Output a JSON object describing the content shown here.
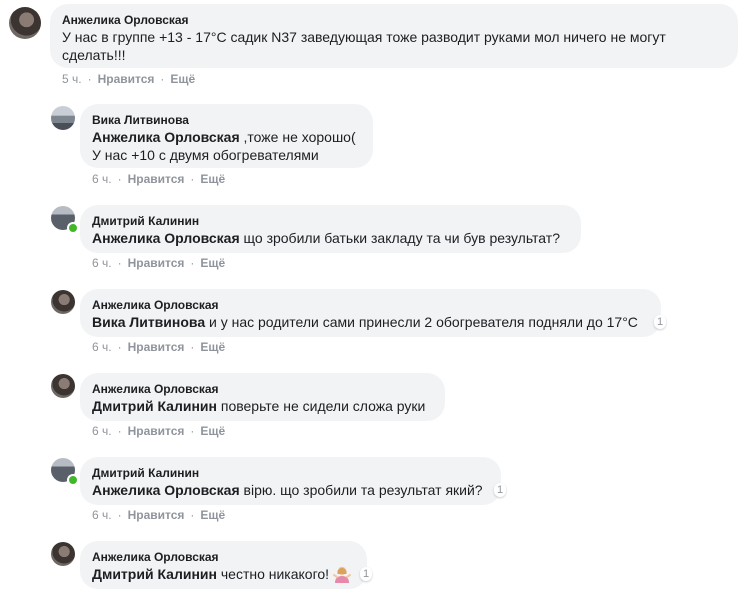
{
  "comments": [
    {
      "author": "Анжелика Орловская",
      "mention": "",
      "text": "У нас в группе +13 - 17°С садик N37 заведующая тоже разводит руками мол ничего не могут сделать!!!",
      "time": "5 ч.",
      "like": "Нравится",
      "more": "Ещё",
      "reactions": ""
    },
    {
      "author": "Вика Литвинова",
      "mention": "Анжелика Орловская",
      "text": ",тоже не хорошо(",
      "text2": "У нас +10 с двумя обогревателями",
      "time": "6 ч.",
      "like": "Нравится",
      "more": "Ещё",
      "reactions": ""
    },
    {
      "author": "Дмитрий Калинин",
      "mention": "Анжелика Орловская",
      "text": "що зробили батьки закладу та чи був результат?",
      "time": "6 ч.",
      "like": "Нравится",
      "more": "Ещё",
      "reactions": ""
    },
    {
      "author": "Анжелика Орловская",
      "mention": "Вика Литвинова",
      "text": "и у нас родители сами принесли 2 обогревателя подняли до 17°С",
      "time": "6 ч.",
      "like": "Нравится",
      "more": "Ещё",
      "reactions": "1"
    },
    {
      "author": "Анжелика Орловская",
      "mention": "Дмитрий Калинин",
      "text": "поверьте не сидели сложа руки",
      "time": "6 ч.",
      "like": "Нравится",
      "more": "Ещё",
      "reactions": ""
    },
    {
      "author": "Дмитрий Калинин",
      "mention": "Анжелика Орловская",
      "text": "вірю. що зробили та результат який?",
      "time": "6 ч.",
      "like": "Нравится",
      "more": "Ещё",
      "reactions": "1"
    },
    {
      "author": "Анжелика Орловская",
      "mention": "Дмитрий Калинин",
      "text": "честно никакого!",
      "time": "",
      "like": "",
      "more": "",
      "reactions": "1",
      "emoji": "woman-shrugging-emoji"
    }
  ],
  "colors": {
    "bubble": "#f2f3f5",
    "meta": "#90949c",
    "presence": "#42b72a"
  }
}
